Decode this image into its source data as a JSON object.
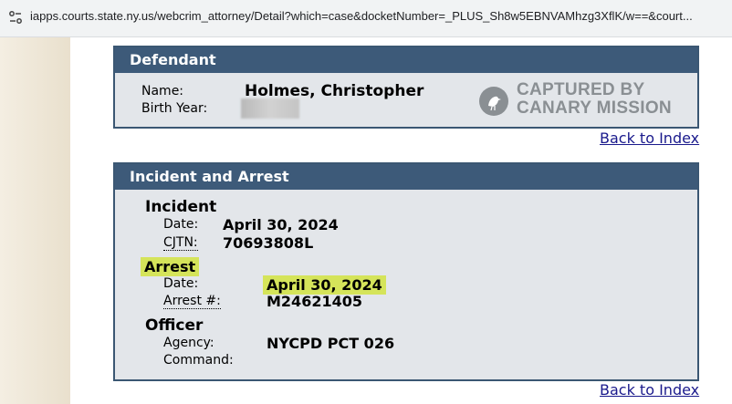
{
  "browser": {
    "url": "iapps.courts.state.ny.us/webcrim_attorney/Detail?which=case&docketNumber=_PLUS_Sh8w5EBNVAMhzg3XflK/w==&court..."
  },
  "defendant": {
    "header": "Defendant",
    "name_label": "Name:",
    "name_value": "Holmes, Christopher",
    "birth_year_label": "Birth Year:",
    "watermark_line1": "CAPTURED BY",
    "watermark_line2": "CANARY MISSION"
  },
  "back_to_index": "Back to Index",
  "incident_arrest": {
    "header": "Incident and Arrest",
    "incident": {
      "title": "Incident",
      "date_label": "Date:",
      "date_value": "April 30, 2024",
      "cjtn_label": "CJTN:",
      "cjtn_value": "70693808L"
    },
    "arrest": {
      "title": "Arrest",
      "date_label": "Date:",
      "date_value": "April 30, 2024",
      "number_label": "Arrest #:",
      "number_value": "M24621405"
    },
    "officer": {
      "title": "Officer",
      "agency_label": "Agency:",
      "agency_value": "NYCPD PCT 026",
      "command_label": "Command:"
    }
  },
  "colors": {
    "header_bg": "#3d5a79",
    "panel_bg": "#e3e6ea",
    "highlight": "#d5e45a",
    "link": "#1a1a8c"
  }
}
